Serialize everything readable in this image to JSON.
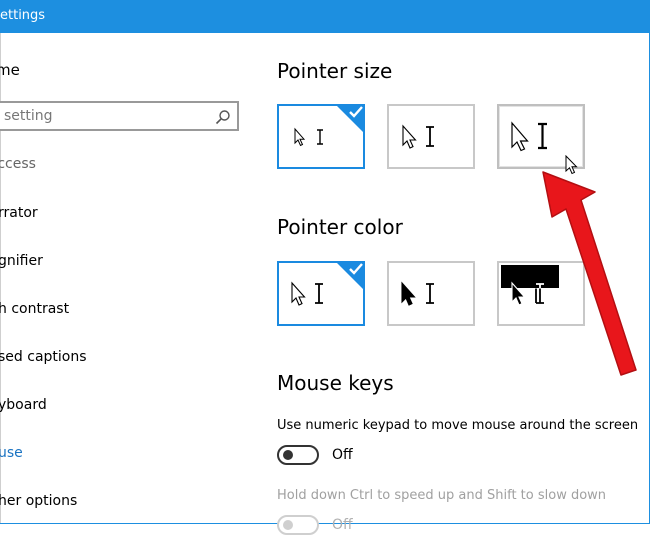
{
  "window": {
    "title": "ettings"
  },
  "sidebar": {
    "home": "me",
    "search_placeholder": "setting",
    "group_header": "Access",
    "items": [
      {
        "label": "rrator",
        "active": false
      },
      {
        "label": "gnifier",
        "active": false
      },
      {
        "label": "h contrast",
        "active": false
      },
      {
        "label": "sed captions",
        "active": false
      },
      {
        "label": "yboard",
        "active": false
      },
      {
        "label": "use",
        "active": true
      },
      {
        "label": "her options",
        "active": false
      }
    ]
  },
  "main": {
    "pointer_size": {
      "heading": "Pointer size",
      "options": [
        {
          "name": "small",
          "selected": true
        },
        {
          "name": "medium",
          "selected": false
        },
        {
          "name": "large",
          "selected": false,
          "hovered": true
        }
      ]
    },
    "pointer_color": {
      "heading": "Pointer color",
      "options": [
        {
          "name": "white",
          "selected": true
        },
        {
          "name": "black",
          "selected": false
        },
        {
          "name": "inverted",
          "selected": false
        }
      ]
    },
    "mouse_keys": {
      "heading": "Mouse keys",
      "numeric_keypad_desc": "Use numeric keypad to move mouse around the screen",
      "numeric_keypad_state": "Off",
      "ctrl_shift_desc": "Hold down Ctrl to speed up and Shift to slow down",
      "ctrl_shift_state": "Off"
    }
  },
  "colors": {
    "accent": "#1a8ae0",
    "annotation_arrow": "#e8161b"
  }
}
